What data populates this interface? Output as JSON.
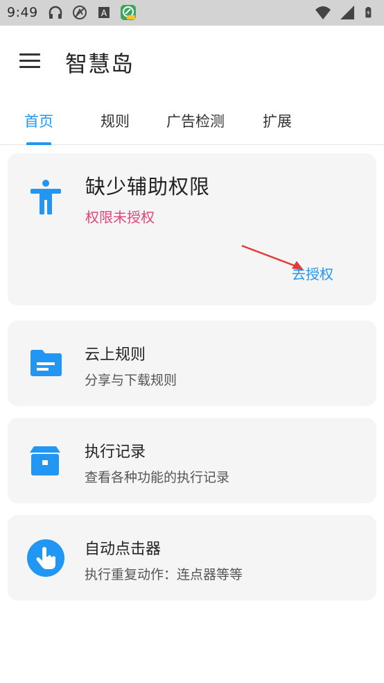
{
  "status_bar": {
    "time": "9:49",
    "icons_left": [
      "headset-icon",
      "no-sync-icon",
      "a-notification-icon",
      "app-notification-icon"
    ],
    "icons_right": [
      "wifi-icon",
      "signal-icon",
      "battery-charging-icon"
    ]
  },
  "app_bar": {
    "title": "智慧岛",
    "menu_icon": "menu-icon"
  },
  "tabs": [
    {
      "label": "首页",
      "active": true
    },
    {
      "label": "规则",
      "active": false
    },
    {
      "label": "广告检测",
      "active": false
    },
    {
      "label": "扩展",
      "active": false
    }
  ],
  "permission_card": {
    "icon": "accessibility-icon",
    "title": "缺少辅助权限",
    "subtitle": "权限未授权",
    "action": "去授权"
  },
  "feature_cards": [
    {
      "icon": "folder-icon",
      "title": "云上规则",
      "subtitle": "分享与下载规则"
    },
    {
      "icon": "archive-icon",
      "title": "执行记录",
      "subtitle": "查看各种功能的执行记录"
    },
    {
      "icon": "touch-icon",
      "title": "自动点击器",
      "subtitle": "执行重复动作：连点器等等"
    }
  ],
  "colors": {
    "accent": "#2196f3",
    "warning_text": "#e0457b",
    "card_bg": "#f5f5f5",
    "status_bar_bg": "#d3d3d3"
  }
}
